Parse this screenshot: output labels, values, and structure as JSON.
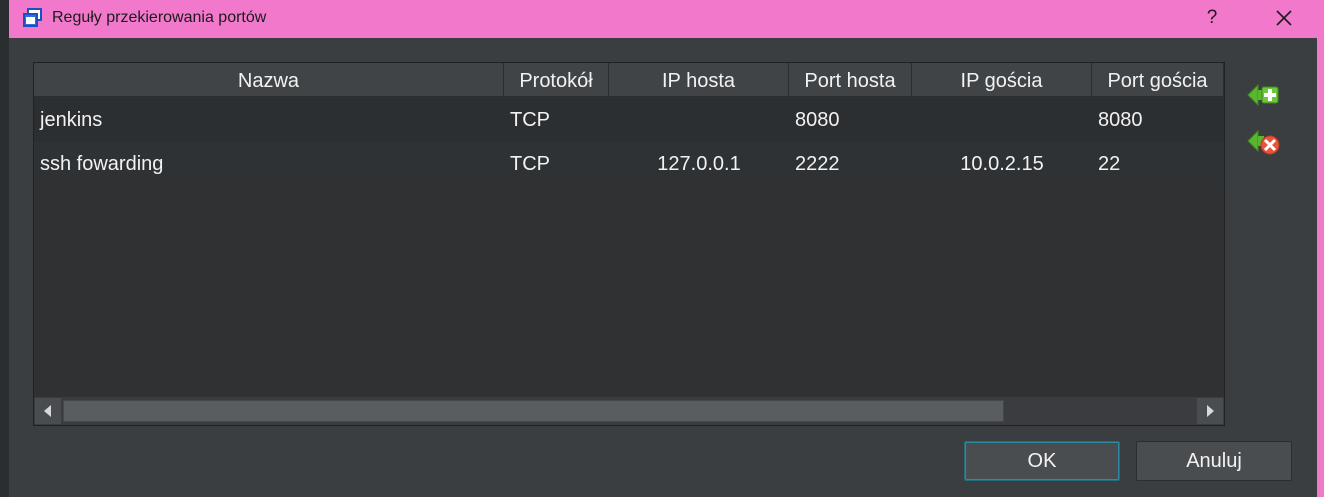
{
  "dialog": {
    "title": "Reguły przekierowania portów",
    "help_label": "?",
    "icon": "virtualbox-window-icon"
  },
  "table": {
    "columns": [
      "Nazwa",
      "Protokół",
      "IP hosta",
      "Port hosta",
      "IP gościa",
      "Port gościa"
    ],
    "rows": [
      {
        "name": "jenkins",
        "protocol": "TCP",
        "host_ip": "",
        "host_port": "8080",
        "guest_ip": "",
        "guest_port": "8080"
      },
      {
        "name": "ssh fowarding",
        "protocol": "TCP",
        "host_ip": "127.0.0.1",
        "host_port": "2222",
        "guest_ip": "10.0.2.15",
        "guest_port": "22"
      }
    ]
  },
  "actions": {
    "add_icon": "add-rule-icon",
    "remove_icon": "remove-rule-icon"
  },
  "buttons": {
    "ok": "OK",
    "cancel": "Anuluj"
  },
  "colors": {
    "titlebar": "#f178cb",
    "window_bg": "#3b3e41",
    "table_bg": "#2f3133",
    "text": "#f2f2f2"
  }
}
